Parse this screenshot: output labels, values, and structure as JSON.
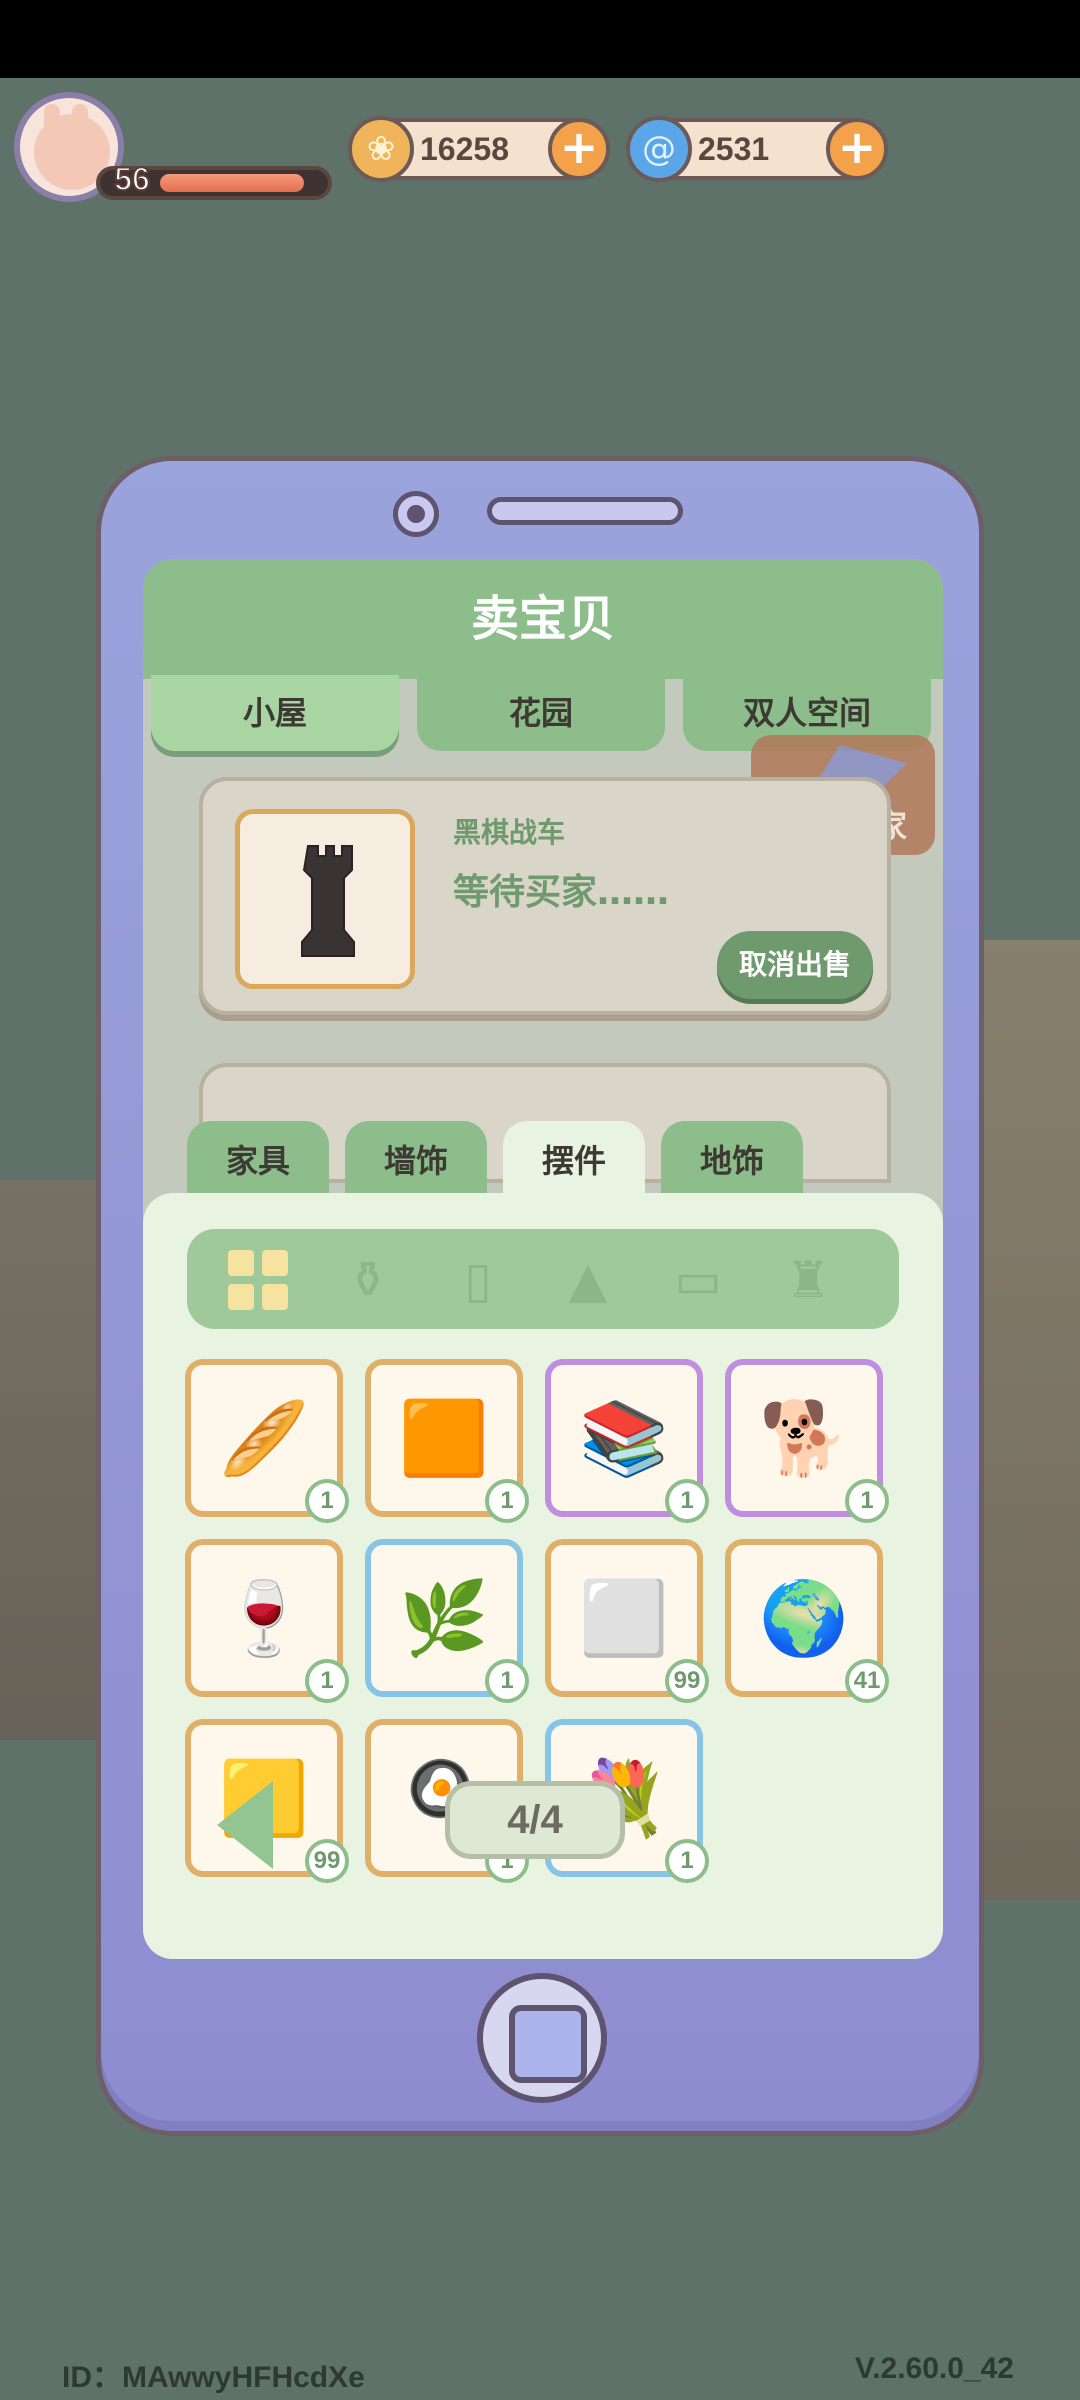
{
  "hud": {
    "level": "56",
    "level_progress": 0.9,
    "coins": {
      "amount": "16258",
      "icon": "leaf-coin-icon"
    },
    "gems": {
      "amount": "2531",
      "icon": "swirl-gem-icon"
    }
  },
  "screen": {
    "title": "卖宝贝",
    "tabs": [
      "小屋",
      "花园",
      "双人空间"
    ],
    "active_tab": "小屋",
    "call_buyer_label": "呼唤买家"
  },
  "sale": {
    "item_name": "黑棋战车",
    "status": "等待买家……",
    "cancel_label": "取消出售"
  },
  "categories": [
    "家具",
    "墙饰",
    "摆件",
    "地饰"
  ],
  "active_category": "摆件",
  "subcategories": [
    "grid-icon",
    "pot-icon",
    "cup-icon",
    "lamp-icon",
    "pillow-icon",
    "bottle-icon"
  ],
  "inventory": [
    {
      "name": "bread-basket",
      "art": "🥖",
      "qty": "1",
      "rarity": "normal"
    },
    {
      "name": "wooden-pillar",
      "art": "🟧",
      "qty": "1",
      "rarity": "normal"
    },
    {
      "name": "desk-clutter",
      "art": "📚",
      "qty": "1",
      "rarity": "epic"
    },
    {
      "name": "anubis-statue",
      "art": "🐕",
      "qty": "1",
      "rarity": "epic"
    },
    {
      "name": "wine-bottle",
      "art": "🍷",
      "qty": "1",
      "rarity": "normal"
    },
    {
      "name": "terrarium",
      "art": "🌿",
      "qty": "1",
      "rarity": "rare"
    },
    {
      "name": "white-pillow",
      "art": "⬜",
      "qty": "99",
      "rarity": "normal"
    },
    {
      "name": "globe",
      "art": "🌍",
      "qty": "41",
      "rarity": "normal"
    },
    {
      "name": "yellow-pillow",
      "art": "🟨",
      "qty": "99",
      "rarity": "normal"
    },
    {
      "name": "grill-pan",
      "art": "🍳",
      "qty": "1",
      "rarity": "normal"
    },
    {
      "name": "flower-basket",
      "art": "💐",
      "qty": "1",
      "rarity": "rare"
    }
  ],
  "pagination": {
    "label": "4/4"
  },
  "footer": {
    "id": "ID：MAwwyHFHcdXe",
    "version": "V.2.60.0_42"
  },
  "colors": {
    "accent_green": "#8cbd8a",
    "phone_body": "#9aa3dc",
    "background": "#5e7269"
  }
}
